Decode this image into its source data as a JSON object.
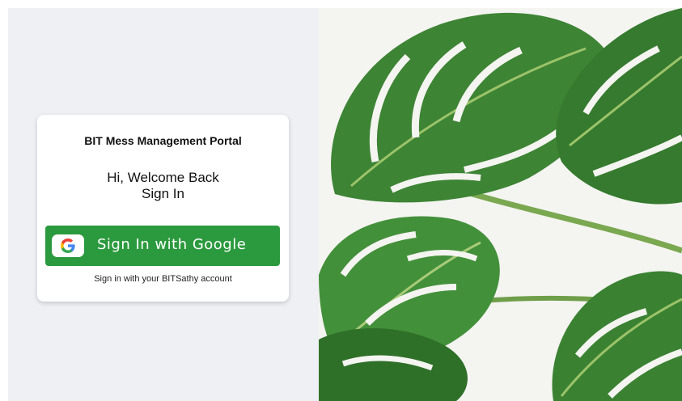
{
  "login_card": {
    "portal_title": "BIT Mess Management Portal",
    "greeting": "Hi, Welcome Back",
    "subheading": "Sign In",
    "google_button_label": "Sign In with Google",
    "google_icon": "google-g-icon",
    "hint_text": "Sign in with your BITSathy account"
  },
  "hero_image": {
    "subject": "monstera leaves"
  },
  "colors": {
    "left_background": "#eef0f4",
    "google_button": "#2b9a3e",
    "card_background": "#ffffff",
    "leaf_green": "#3f8a37"
  }
}
